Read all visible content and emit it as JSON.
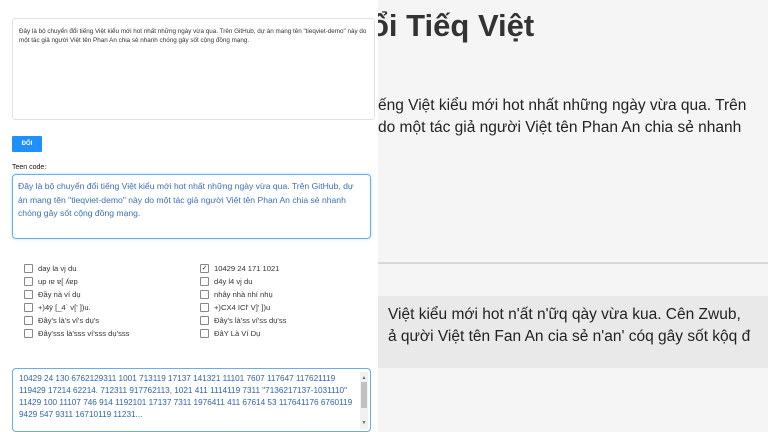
{
  "left": {
    "input_text": "Đây là bộ chuyển đổi tiếng Việt kiểu mới hot nhất những ngày vừa qua. Trên GitHub, dự án mang tên \"tieqviet-demo\" này do một tác giả người Việt tên Phan An chia sẻ nhanh chóng gây sốt cộng đồng mạng.",
    "convert_button": "ĐỔI",
    "teen_code_label": "Teen code:",
    "teen_output": "Đây là bộ chuyển đổi tiếng Việt kiểu mới hot nhất những ngày vừa qua. Trên GitHub, dự án mang tên \"tieqviet-demo\" này do một tác giả người Việt tên Phan An chia sẻ nhanh chóng gây sốt cộng đồng mạng.",
    "options": [
      {
        "label": "day la vj du",
        "checked": false
      },
      {
        "label": "10429 24 171 1021",
        "checked": true
      },
      {
        "label": "up ıɐ ɐ[ ʎɐp",
        "checked": false
      },
      {
        "label": "d4y l4 vj du",
        "checked": false
      },
      {
        "label": "Đầy nà ví dụ",
        "checked": false
      },
      {
        "label": "nhây nhà nhí nhụ",
        "checked": false
      },
      {
        "label": "+)4ÿ [_4` v[' ])u.",
        "checked": false
      },
      {
        "label": "+)CX4 ICl' V]' ])u",
        "checked": false
      },
      {
        "label": "Đây's là's ví's dụ's",
        "checked": false
      },
      {
        "label": "Đây's là'ss ví'ss dụ'ss",
        "checked": false
      },
      {
        "label": "Đây'sss là'sss ví'sss dụ'sss",
        "checked": false
      },
      {
        "label": "ĐâY Là Ví Dụ",
        "checked": false
      }
    ],
    "numeric_output": "10429 24 130 6762129311 1001 713119 17137 141321 11101 7607 117647 117621119 119429 17214 62214. 712311 917762113, 1021 411 1114119 7311 \"7136217137-1031110\" 11429 100 11107 746 914 1192101 17137 7311 1976411 411 67614 53 117641176 6760119 9429 547 9311 16710119 11231..."
  },
  "right": {
    "title": "ổi Tiếq Việt",
    "body_line1": "ếng Việt kiểu mới hot nhất những ngày vừa qua. Trên",
    "body_line2": "do một tác giả người Việt tên Phan An chia sẻ nhanh",
    "teen_line1": "Việt kiểu mới hot n'ất n'ữq qày vừa kua. Cên Zwub,",
    "teen_line2": "ả qười Việt tên Fan An cia sẻ n'an' cóq gây sốt kộq đ"
  }
}
